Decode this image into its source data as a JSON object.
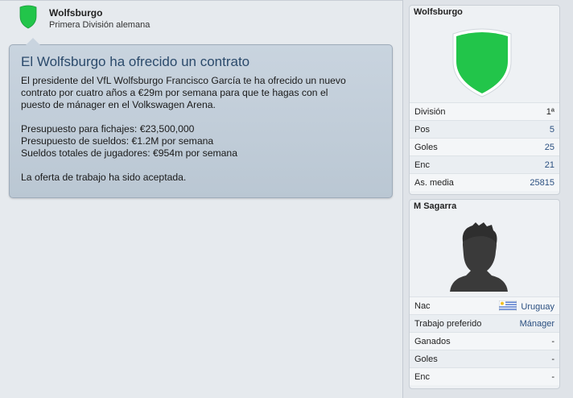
{
  "header": {
    "club_name": "Wolfsburgo",
    "league": "Primera División alemana"
  },
  "message": {
    "title": "El Wolfsburgo ha ofrecido un contrato",
    "paragraph1": "El presidente del VfL Wolfsburgo Francisco García te ha ofrecido un nuevo\ncontrato por cuatro años a €29m por semana para que te hagas con el\npuesto de mánager en el Volkswagen Arena.",
    "budget_transfer": "Presupuesto para fichajes: €23,500,000",
    "budget_wages": "Presupuesto de sueldos: €1.2M por semana",
    "total_wages": "Sueldos totales de jugadores: €954m por semana",
    "status": "La oferta de trabajo ha sido aceptada."
  },
  "club_panel": {
    "title": "Wolfsburgo",
    "shield_color": "#22c54a",
    "rows": [
      {
        "label": "División",
        "value": "1ª"
      },
      {
        "label": "Pos",
        "value": "5"
      },
      {
        "label": "Goles",
        "value": "25"
      },
      {
        "label": "Enc",
        "value": "21"
      },
      {
        "label": "As. media",
        "value": "25815"
      }
    ]
  },
  "manager_panel": {
    "title": "M Sagarra",
    "rows": [
      {
        "label": "Nac",
        "value": "Uruguay",
        "icon": "uruguay-flag-icon"
      },
      {
        "label": "Trabajo preferido",
        "value": "Mánager"
      },
      {
        "label": "Ganados",
        "value": "-"
      },
      {
        "label": "Goles",
        "value": "-"
      },
      {
        "label": "Enc",
        "value": "-"
      }
    ]
  }
}
